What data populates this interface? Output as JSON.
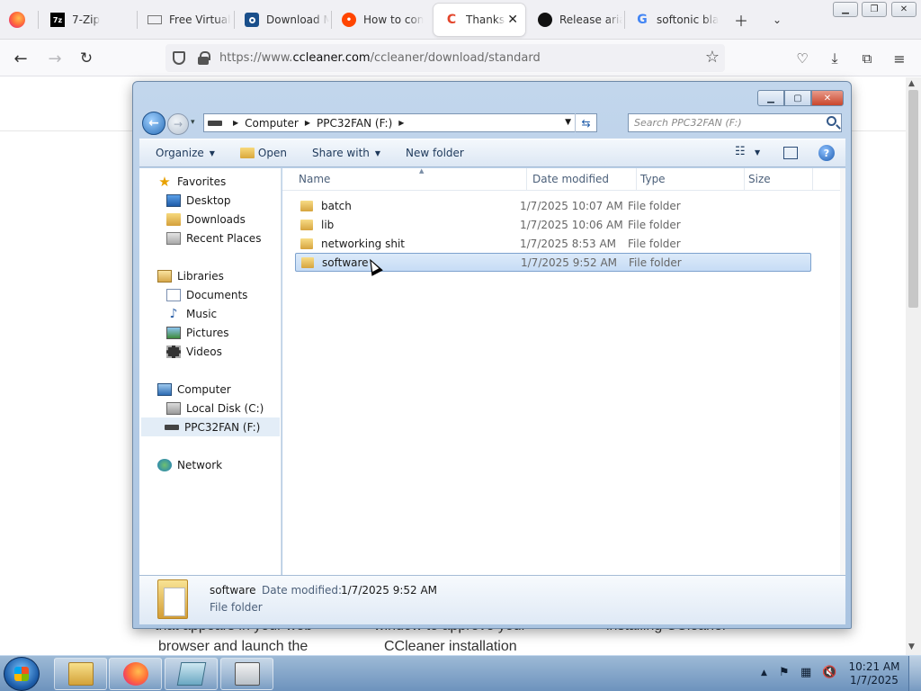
{
  "browser": {
    "tabs": [
      {
        "label": "7-Zip",
        "icon": "7zip-icon"
      },
      {
        "label": "Free Virtual",
        "icon": "keyboard-icon"
      },
      {
        "label": "Download M",
        "icon": "square-logo-icon"
      },
      {
        "label": "How to con",
        "icon": "reddit-icon"
      },
      {
        "label": "Thanks fo",
        "icon": "ccleaner-icon"
      },
      {
        "label": "Release aria",
        "icon": "github-icon"
      },
      {
        "label": "softonic bla",
        "icon": "google-icon"
      }
    ],
    "url_prefix": "https://www.",
    "url_domain": "ccleaner.com",
    "url_path": "/ccleaner/download/standard"
  },
  "page_snippets": {
    "col1_line1": "that appears in your web",
    "col1_line2": "browser and launch the",
    "col2_line1": "window to approve your",
    "col2_line2": "CCleaner installation",
    "col3_line1": "installing CCleaner"
  },
  "explorer": {
    "breadcrumb": [
      "Computer",
      "PPC32FAN (F:)"
    ],
    "search_placeholder": "Search PPC32FAN (F:)",
    "toolbar": {
      "organize": "Organize",
      "open": "Open",
      "share_with": "Share with",
      "new_folder": "New folder"
    },
    "nav": {
      "favorites": "Favorites",
      "desktop": "Desktop",
      "downloads": "Downloads",
      "recent_places": "Recent Places",
      "libraries": "Libraries",
      "documents": "Documents",
      "music": "Music",
      "pictures": "Pictures",
      "videos": "Videos",
      "computer": "Computer",
      "local_disk": "Local Disk (C:)",
      "usb_drive": "PPC32FAN (F:)",
      "network": "Network"
    },
    "columns": {
      "name": "Name",
      "date": "Date modified",
      "type": "Type",
      "size": "Size"
    },
    "rows": [
      {
        "name": "batch",
        "date": "1/7/2025 10:07 AM",
        "type": "File folder"
      },
      {
        "name": "lib",
        "date": "1/7/2025 10:06 AM",
        "type": "File folder"
      },
      {
        "name": "networking shit",
        "date": "1/7/2025 8:53 AM",
        "type": "File folder"
      },
      {
        "name": "software",
        "date": "1/7/2025 9:52 AM",
        "type": "File folder"
      }
    ],
    "selected_index": 3,
    "details": {
      "name": "software",
      "modified_label": "Date modified:",
      "modified_value": "1/7/2025 9:52 AM",
      "type": "File folder"
    }
  },
  "taskbar": {
    "time": "10:21 AM",
    "date": "1/7/2025"
  },
  "colors": {
    "selection": "#cce2f8",
    "explorer_frame": "#aac4e1",
    "taskbar": "#7fa2c8"
  }
}
